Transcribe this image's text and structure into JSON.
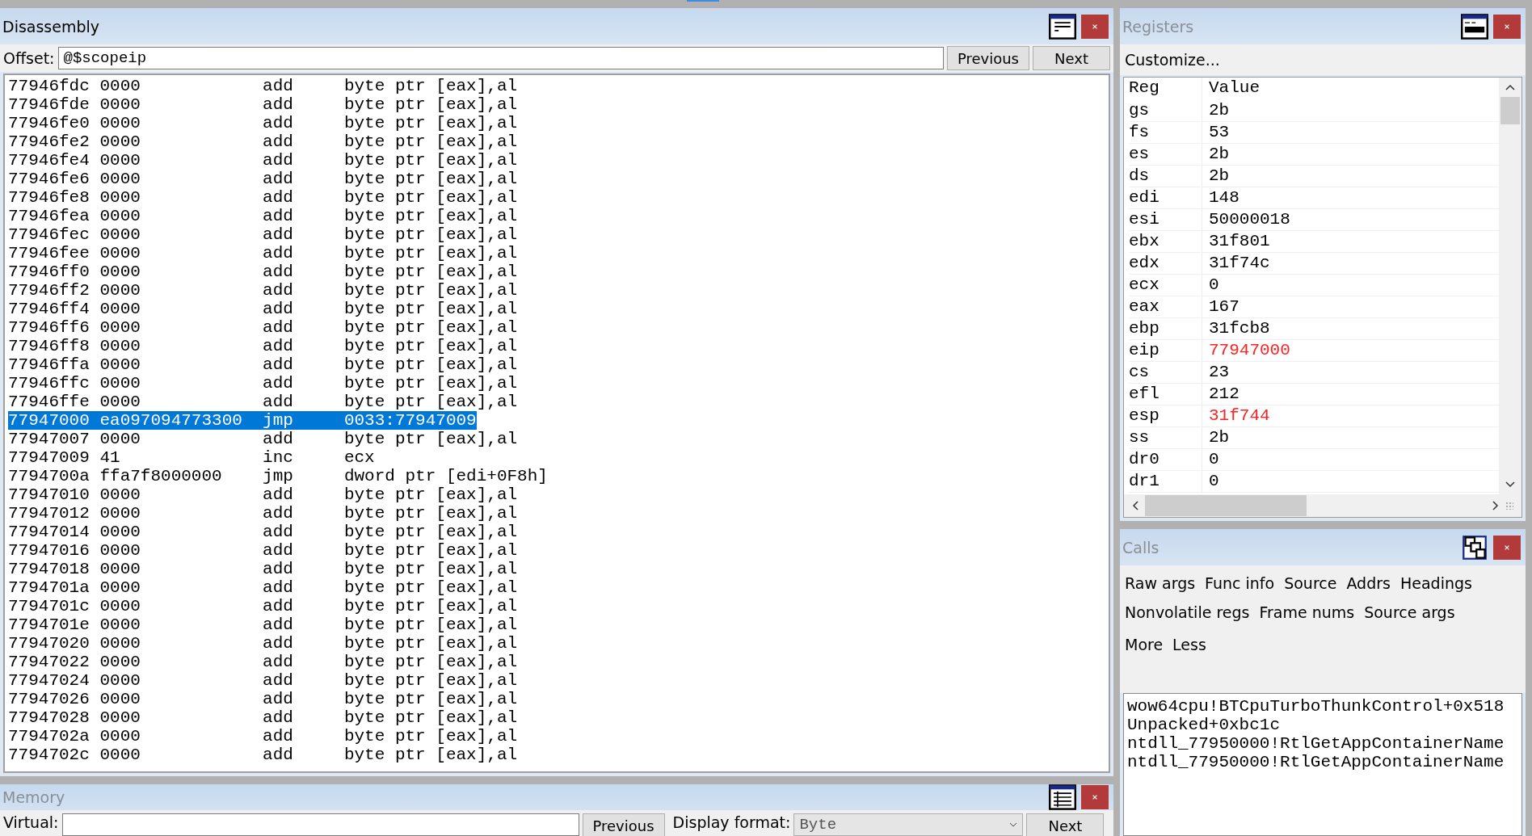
{
  "disassembly": {
    "title": "Disassembly",
    "offset_label": "Offset:",
    "offset_value": "@$scopeip",
    "buttons": [
      "Previous",
      "Next"
    ],
    "rows": [
      {
        "address": "77946fdc",
        "bytes": "0000",
        "mnemonic": "add",
        "operands": "byte ptr [eax],al",
        "selected": false
      },
      {
        "address": "77946fde",
        "bytes": "0000",
        "mnemonic": "add",
        "operands": "byte ptr [eax],al",
        "selected": false
      },
      {
        "address": "77946fe0",
        "bytes": "0000",
        "mnemonic": "add",
        "operands": "byte ptr [eax],al",
        "selected": false
      },
      {
        "address": "77946fe2",
        "bytes": "0000",
        "mnemonic": "add",
        "operands": "byte ptr [eax],al",
        "selected": false
      },
      {
        "address": "77946fe4",
        "bytes": "0000",
        "mnemonic": "add",
        "operands": "byte ptr [eax],al",
        "selected": false
      },
      {
        "address": "77946fe6",
        "bytes": "0000",
        "mnemonic": "add",
        "operands": "byte ptr [eax],al",
        "selected": false
      },
      {
        "address": "77946fe8",
        "bytes": "0000",
        "mnemonic": "add",
        "operands": "byte ptr [eax],al",
        "selected": false
      },
      {
        "address": "77946fea",
        "bytes": "0000",
        "mnemonic": "add",
        "operands": "byte ptr [eax],al",
        "selected": false
      },
      {
        "address": "77946fec",
        "bytes": "0000",
        "mnemonic": "add",
        "operands": "byte ptr [eax],al",
        "selected": false
      },
      {
        "address": "77946fee",
        "bytes": "0000",
        "mnemonic": "add",
        "operands": "byte ptr [eax],al",
        "selected": false
      },
      {
        "address": "77946ff0",
        "bytes": "0000",
        "mnemonic": "add",
        "operands": "byte ptr [eax],al",
        "selected": false
      },
      {
        "address": "77946ff2",
        "bytes": "0000",
        "mnemonic": "add",
        "operands": "byte ptr [eax],al",
        "selected": false
      },
      {
        "address": "77946ff4",
        "bytes": "0000",
        "mnemonic": "add",
        "operands": "byte ptr [eax],al",
        "selected": false
      },
      {
        "address": "77946ff6",
        "bytes": "0000",
        "mnemonic": "add",
        "operands": "byte ptr [eax],al",
        "selected": false
      },
      {
        "address": "77946ff8",
        "bytes": "0000",
        "mnemonic": "add",
        "operands": "byte ptr [eax],al",
        "selected": false
      },
      {
        "address": "77946ffa",
        "bytes": "0000",
        "mnemonic": "add",
        "operands": "byte ptr [eax],al",
        "selected": false
      },
      {
        "address": "77946ffc",
        "bytes": "0000",
        "mnemonic": "add",
        "operands": "byte ptr [eax],al",
        "selected": false
      },
      {
        "address": "77946ffe",
        "bytes": "0000",
        "mnemonic": "add",
        "operands": "byte ptr [eax],al",
        "selected": false
      },
      {
        "address": "77947000",
        "bytes": "ea097094773300",
        "mnemonic": "jmp",
        "operands": "0033:77947009",
        "selected": true
      },
      {
        "address": "77947007",
        "bytes": "0000",
        "mnemonic": "add",
        "operands": "byte ptr [eax],al",
        "selected": false
      },
      {
        "address": "77947009",
        "bytes": "41",
        "mnemonic": "inc",
        "operands": "ecx",
        "selected": false
      },
      {
        "address": "7794700a",
        "bytes": "ffa7f8000000",
        "mnemonic": "jmp",
        "operands": "dword ptr [edi+0F8h]",
        "selected": false
      },
      {
        "address": "77947010",
        "bytes": "0000",
        "mnemonic": "add",
        "operands": "byte ptr [eax],al",
        "selected": false
      },
      {
        "address": "77947012",
        "bytes": "0000",
        "mnemonic": "add",
        "operands": "byte ptr [eax],al",
        "selected": false
      },
      {
        "address": "77947014",
        "bytes": "0000",
        "mnemonic": "add",
        "operands": "byte ptr [eax],al",
        "selected": false
      },
      {
        "address": "77947016",
        "bytes": "0000",
        "mnemonic": "add",
        "operands": "byte ptr [eax],al",
        "selected": false
      },
      {
        "address": "77947018",
        "bytes": "0000",
        "mnemonic": "add",
        "operands": "byte ptr [eax],al",
        "selected": false
      },
      {
        "address": "7794701a",
        "bytes": "0000",
        "mnemonic": "add",
        "operands": "byte ptr [eax],al",
        "selected": false
      },
      {
        "address": "7794701c",
        "bytes": "0000",
        "mnemonic": "add",
        "operands": "byte ptr [eax],al",
        "selected": false
      },
      {
        "address": "7794701e",
        "bytes": "0000",
        "mnemonic": "add",
        "operands": "byte ptr [eax],al",
        "selected": false
      },
      {
        "address": "77947020",
        "bytes": "0000",
        "mnemonic": "add",
        "operands": "byte ptr [eax],al",
        "selected": false
      },
      {
        "address": "77947022",
        "bytes": "0000",
        "mnemonic": "add",
        "operands": "byte ptr [eax],al",
        "selected": false
      },
      {
        "address": "77947024",
        "bytes": "0000",
        "mnemonic": "add",
        "operands": "byte ptr [eax],al",
        "selected": false
      },
      {
        "address": "77947026",
        "bytes": "0000",
        "mnemonic": "add",
        "operands": "byte ptr [eax],al",
        "selected": false
      },
      {
        "address": "77947028",
        "bytes": "0000",
        "mnemonic": "add",
        "operands": "byte ptr [eax],al",
        "selected": false
      },
      {
        "address": "7794702a",
        "bytes": "0000",
        "mnemonic": "add",
        "operands": "byte ptr [eax],al",
        "selected": false
      },
      {
        "address": "7794702c",
        "bytes": "0000",
        "mnemonic": "add",
        "operands": "byte ptr [eax],al",
        "selected": false
      }
    ]
  },
  "memory": {
    "title": "Memory",
    "virtual_label": "Virtual:",
    "buttons": [
      "Previous",
      "Next"
    ],
    "display_format_label": "Display format:",
    "display_format_value": "Byte"
  },
  "registers": {
    "title": "Registers",
    "customize": "Customize...",
    "columns": [
      "Reg",
      "Value"
    ],
    "rows": [
      {
        "reg": "gs",
        "value": "2b",
        "changed": false
      },
      {
        "reg": "fs",
        "value": "53",
        "changed": false
      },
      {
        "reg": "es",
        "value": "2b",
        "changed": false
      },
      {
        "reg": "ds",
        "value": "2b",
        "changed": false
      },
      {
        "reg": "edi",
        "value": "148",
        "changed": false
      },
      {
        "reg": "esi",
        "value": "50000018",
        "changed": false
      },
      {
        "reg": "ebx",
        "value": "31f801",
        "changed": false
      },
      {
        "reg": "edx",
        "value": "31f74c",
        "changed": false
      },
      {
        "reg": "ecx",
        "value": "0",
        "changed": false
      },
      {
        "reg": "eax",
        "value": "167",
        "changed": false
      },
      {
        "reg": "ebp",
        "value": "31fcb8",
        "changed": false
      },
      {
        "reg": "eip",
        "value": "77947000",
        "changed": true
      },
      {
        "reg": "cs",
        "value": "23",
        "changed": false
      },
      {
        "reg": "efl",
        "value": "212",
        "changed": false
      },
      {
        "reg": "esp",
        "value": "31f744",
        "changed": true
      },
      {
        "reg": "ss",
        "value": "2b",
        "changed": false
      },
      {
        "reg": "dr0",
        "value": "0",
        "changed": false
      },
      {
        "reg": "dr1",
        "value": "0",
        "changed": false
      }
    ]
  },
  "calls": {
    "title": "Calls",
    "option_rows": [
      [
        "Raw args",
        "Func info",
        "Source",
        "Addrs",
        "Headings"
      ],
      [
        "Nonvolatile regs",
        "Frame nums",
        "Source args"
      ],
      [
        "More",
        "Less"
      ]
    ],
    "frames": [
      "wow64cpu!BTCpuTurboThunkControl+0x518",
      "Unpacked+0xbc1c",
      "ntdll_77950000!RtlGetAppContainerName",
      "ntdll_77950000!RtlGetAppContainerName"
    ]
  }
}
